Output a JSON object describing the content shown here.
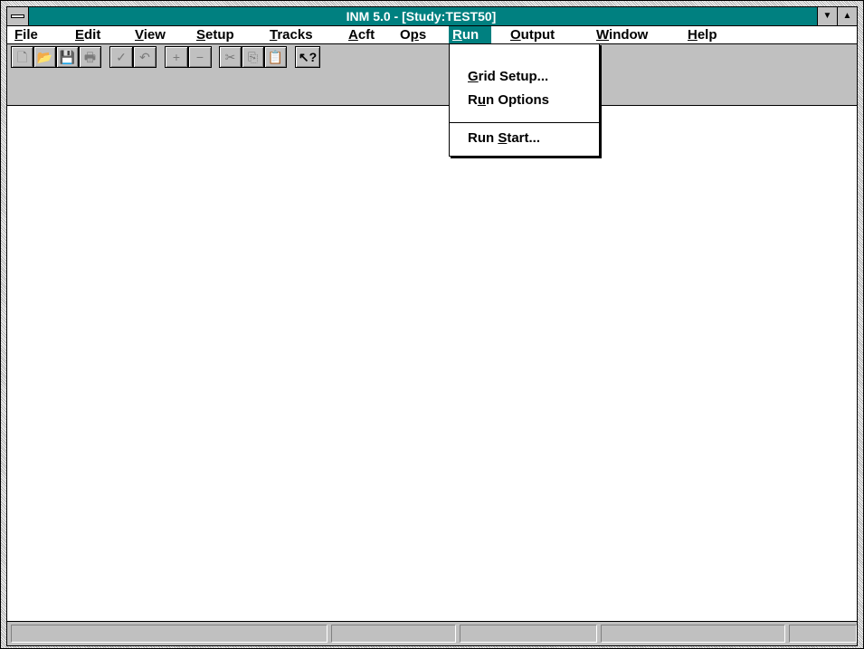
{
  "window": {
    "title": "INM 5.0 - [Study:TEST50]",
    "minimize_glyph": "▼",
    "maximize_glyph": "▲"
  },
  "menubar": {
    "items": [
      {
        "pre": "",
        "u": "F",
        "post": "ile"
      },
      {
        "pre": "",
        "u": "E",
        "post": "dit"
      },
      {
        "pre": "",
        "u": "V",
        "post": "iew"
      },
      {
        "pre": "",
        "u": "S",
        "post": "etup"
      },
      {
        "pre": "",
        "u": "T",
        "post": "racks"
      },
      {
        "pre": "",
        "u": "A",
        "post": "cft"
      },
      {
        "pre": "O",
        "u": "p",
        "post": "s"
      },
      {
        "pre": "",
        "u": "R",
        "post": "un"
      },
      {
        "pre": "",
        "u": "O",
        "post": "utput"
      },
      {
        "pre": "",
        "u": "W",
        "post": "indow"
      },
      {
        "pre": "",
        "u": "H",
        "post": "elp"
      }
    ]
  },
  "run_menu": {
    "items": [
      {
        "pre": "",
        "u": "G",
        "post": "rid Setup..."
      },
      {
        "pre": "R",
        "u": "u",
        "post": "n Options"
      },
      {
        "pre": "Run ",
        "u": "S",
        "post": "tart..."
      }
    ]
  },
  "toolbar": {
    "buttons": [
      {
        "name": "new-icon",
        "glyph": "🗋"
      },
      {
        "name": "open-icon",
        "glyph": "📂"
      },
      {
        "name": "save-icon",
        "glyph": "💾"
      },
      {
        "name": "print-icon",
        "glyph": "🖶"
      },
      {
        "name": "check-icon",
        "glyph": "✓"
      },
      {
        "name": "undo-icon",
        "glyph": "↶"
      },
      {
        "name": "add-icon",
        "glyph": "+"
      },
      {
        "name": "remove-icon",
        "glyph": "−"
      },
      {
        "name": "cut-icon",
        "glyph": "✂"
      },
      {
        "name": "copy-icon",
        "glyph": "⎘"
      },
      {
        "name": "paste-icon",
        "glyph": "📋"
      },
      {
        "name": "help-context-icon",
        "glyph": "↖?"
      }
    ]
  },
  "statusbar": {
    "panes": [
      "",
      "",
      "",
      "",
      ""
    ]
  }
}
